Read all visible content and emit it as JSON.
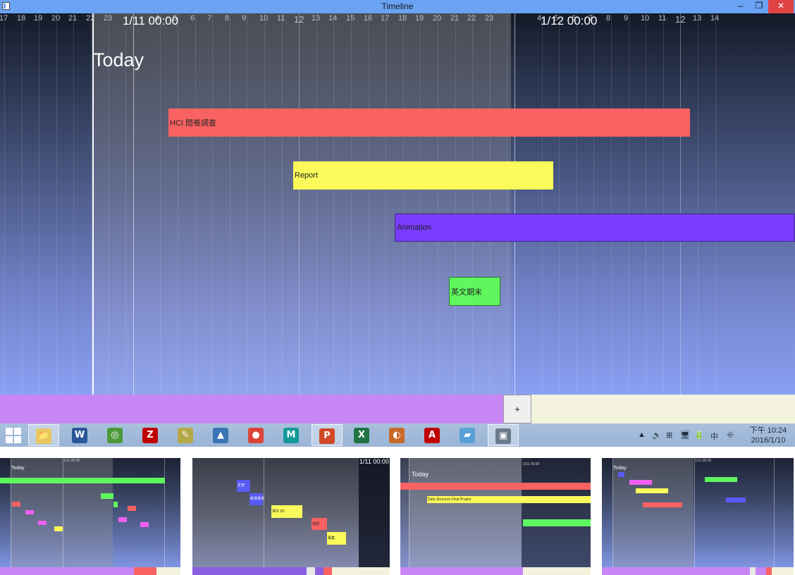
{
  "window": {
    "title": "Timeline",
    "minimize_glyph": "–",
    "maximize_glyph": "❐",
    "close_glyph": "✕"
  },
  "timeline": {
    "ruler_ticks": [
      "17",
      "18",
      "19",
      "20",
      "21",
      "22",
      "23",
      "1/11 00:00",
      "",
      "4",
      "5",
      "6",
      "7",
      "8",
      "9",
      "10",
      "11",
      "12",
      "13",
      "14",
      "15",
      "16",
      "17",
      "18",
      "19",
      "20",
      "21",
      "22",
      "23",
      "1/12 00:00",
      "",
      "4",
      "5",
      "6",
      "7",
      "8",
      "9",
      "10",
      "11",
      "12",
      "13",
      "14"
    ],
    "day_labels": [
      "1/11 00:00",
      "1/12 00:00"
    ],
    "today_label": "Today",
    "tasks": [
      {
        "name": "HCI 問卷調查",
        "color": "#f96262"
      },
      {
        "name": "Report",
        "color": "#fafa5a"
      },
      {
        "name": "Animation",
        "color": "#7a3cfc"
      },
      {
        "name": "英文期末",
        "color": "#5ef85e"
      }
    ]
  },
  "bottom_bar": {
    "add_label": "+",
    "left_color": "#c886f4",
    "right_color": "#f3f3dd"
  },
  "taskbar": {
    "apps": [
      {
        "name": "file-explorer",
        "glyph": "📁",
        "color": "#e8c660",
        "active": true
      },
      {
        "name": "word",
        "glyph": "W",
        "color": "#2b579a",
        "active": false
      },
      {
        "name": "map-tool",
        "glyph": "◎",
        "color": "#4c9a3c",
        "active": false
      },
      {
        "name": "filezilla",
        "glyph": "Z",
        "color": "#bf0000",
        "active": false
      },
      {
        "name": "text-editor",
        "glyph": "✎",
        "color": "#b5a848",
        "active": false
      },
      {
        "name": "python",
        "glyph": "▲",
        "color": "#3b74b4",
        "active": false
      },
      {
        "name": "chrome",
        "glyph": "●",
        "color": "#db4437",
        "active": false
      },
      {
        "name": "maya",
        "glyph": "M",
        "color": "#139999",
        "active": false
      },
      {
        "name": "powerpoint",
        "glyph": "P",
        "color": "#d24726",
        "active": true
      },
      {
        "name": "excel",
        "glyph": "X",
        "color": "#217346",
        "active": false
      },
      {
        "name": "media-tool",
        "glyph": "◐",
        "color": "#c86a2a",
        "active": false
      },
      {
        "name": "acrobat",
        "glyph": "A",
        "color": "#c00000",
        "active": false
      },
      {
        "name": "notes",
        "glyph": "▰",
        "color": "#5aa0d6",
        "active": false
      },
      {
        "name": "timeline-app",
        "glyph": "▣",
        "color": "#6a7a8a",
        "active": true
      }
    ],
    "tray_icons": [
      "▲",
      "🔊",
      "⊞",
      "🖥",
      "🔋",
      "中",
      "⎆"
    ],
    "time": "下午 10:24",
    "date": "2016/1/10"
  },
  "thumbnails": [
    {
      "today_label": "Today",
      "date_label": "1/11 00:00"
    },
    {
      "date_label": "1/11 00:00",
      "tasks": [
        "正佳",
        "新增事項",
        "事件 3D",
        "拍照",
        "專案"
      ]
    },
    {
      "today_label": "Today",
      "date_label": "1/11 00:00",
      "task": "Data Structure Final Project"
    },
    {
      "today_label": "Today",
      "date_label": "1/11 00:00"
    }
  ]
}
